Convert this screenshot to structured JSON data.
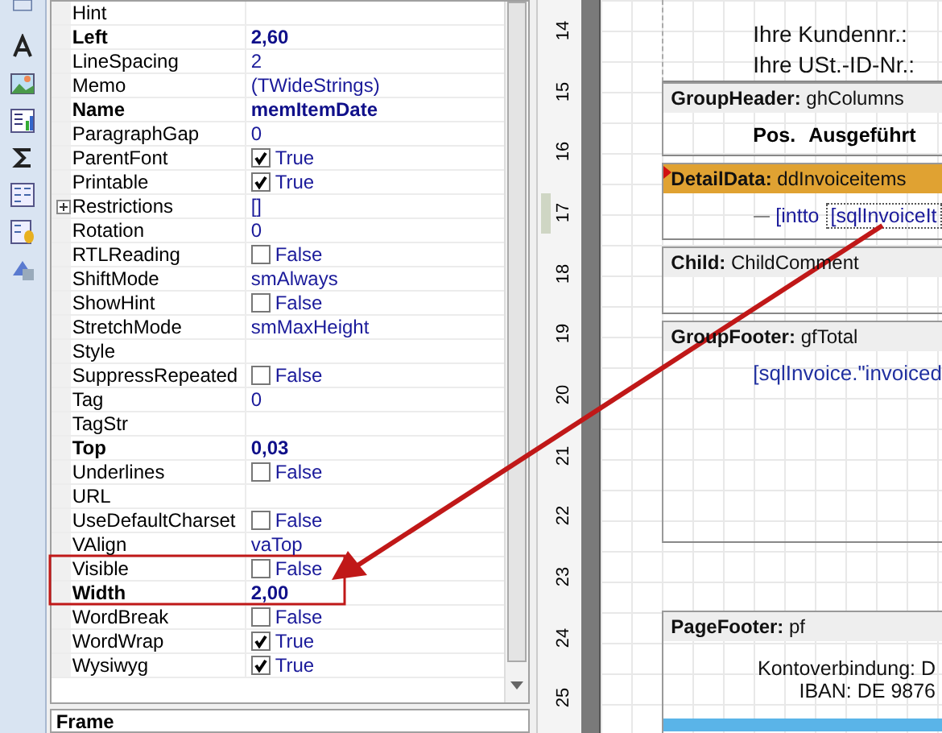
{
  "properties": [
    {
      "name": "Hint",
      "kind": "text",
      "bold": false
    },
    {
      "name": "Left",
      "value": "2,60",
      "kind": "text",
      "bold": true
    },
    {
      "name": "LineSpacing",
      "value": "2",
      "kind": "text",
      "bold": false
    },
    {
      "name": "Memo",
      "value": "(TWideStrings)",
      "kind": "text",
      "bold": false
    },
    {
      "name": "Name",
      "value": "memItemDate",
      "kind": "text",
      "bold": true
    },
    {
      "name": "ParagraphGap",
      "value": "0",
      "kind": "text",
      "bold": false
    },
    {
      "name": "ParentFont",
      "value": "True",
      "kind": "check",
      "checked": true,
      "bold": false
    },
    {
      "name": "Printable",
      "value": "True",
      "kind": "check",
      "checked": true,
      "bold": false
    },
    {
      "name": "Restrictions",
      "value": "[]",
      "kind": "set",
      "expanded": false,
      "bold": false
    },
    {
      "name": "Rotation",
      "value": "0",
      "kind": "text",
      "bold": false
    },
    {
      "name": "RTLReading",
      "value": "False",
      "kind": "check",
      "checked": false,
      "bold": false
    },
    {
      "name": "ShiftMode",
      "value": "smAlways",
      "kind": "text",
      "bold": false
    },
    {
      "name": "ShowHint",
      "value": "False",
      "kind": "check",
      "checked": false,
      "bold": false
    },
    {
      "name": "StretchMode",
      "value": "smMaxHeight",
      "kind": "text",
      "bold": false
    },
    {
      "name": "Style",
      "kind": "text",
      "bold": false
    },
    {
      "name": "SuppressRepeated",
      "value": "False",
      "kind": "check",
      "checked": false,
      "bold": false
    },
    {
      "name": "Tag",
      "value": "0",
      "kind": "text",
      "bold": false
    },
    {
      "name": "TagStr",
      "kind": "text",
      "bold": false
    },
    {
      "name": "Top",
      "value": "0,03",
      "kind": "text",
      "bold": true
    },
    {
      "name": "Underlines",
      "value": "False",
      "kind": "check",
      "checked": false,
      "bold": false
    },
    {
      "name": "URL",
      "kind": "text",
      "bold": false
    },
    {
      "name": "UseDefaultCharset",
      "value": "False",
      "kind": "check",
      "checked": false,
      "bold": false
    },
    {
      "name": "VAlign",
      "value": "vaTop",
      "kind": "text",
      "bold": false
    },
    {
      "name": "Visible",
      "value": "False",
      "kind": "check",
      "checked": false,
      "bold": false
    },
    {
      "name": "Width",
      "value": "2,00",
      "kind": "text",
      "bold": true
    },
    {
      "name": "WordBreak",
      "value": "False",
      "kind": "check",
      "checked": false,
      "bold": false
    },
    {
      "name": "WordWrap",
      "value": "True",
      "kind": "check",
      "checked": true,
      "bold": false
    },
    {
      "name": "Wysiwyg",
      "value": "True",
      "kind": "check",
      "checked": true,
      "bold": false
    }
  ],
  "bottom_panel": {
    "title": "Frame"
  },
  "ruler": [
    "14",
    "15",
    "16",
    "17",
    "18",
    "19",
    "20",
    "21",
    "22",
    "23",
    "24",
    "25"
  ],
  "report": {
    "header_lines": [
      "Ihre Kundennr.:",
      "Ihre USt.-ID-Nr.:"
    ],
    "bands": [
      {
        "title": "GroupHeader:",
        "name": "ghColumns",
        "selected": false,
        "texts": [
          "Pos.",
          "Ausgeführt"
        ],
        "kind": "columns"
      },
      {
        "title": "DetailData:",
        "name": "ddInvoiceitems",
        "selected": true,
        "texts": [
          "[intto",
          "[sqlInvoiceIt"
        ],
        "kind": "detail"
      },
      {
        "title": "Child:",
        "name": "ChildComment",
        "selected": false,
        "kind": "empty"
      },
      {
        "title": "GroupFooter:",
        "name": "gfTotal",
        "selected": false,
        "texts": [
          "[sqlInvoice.\"invoiced"
        ],
        "kind": "total"
      },
      {
        "title": "PageFooter:",
        "name": "pf",
        "selected": false,
        "texts": [
          "Kontoverbindung: D",
          "IBAN: DE 9876"
        ],
        "kind": "footer"
      }
    ]
  }
}
